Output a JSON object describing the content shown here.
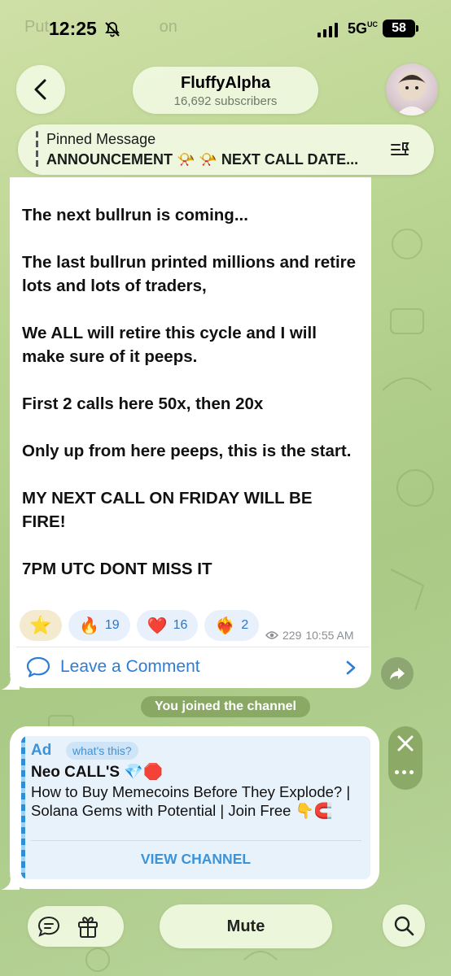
{
  "status_bar": {
    "time": "12:25",
    "network": "5G",
    "network_sup": "UC",
    "battery": "58"
  },
  "background_ghost": {
    "prev_title": "Put",
    "prev_title_end": "on"
  },
  "header": {
    "back_icon": "chevron-left-icon",
    "channel_name": "FluffyAlpha",
    "subscribers": "16,692 subscribers"
  },
  "pinned": {
    "title": "Pinned Message",
    "text": "ANNOUNCEMENT 📯 📯 NEXT CALL DATE..."
  },
  "message": {
    "paragraphs": [
      "The next bullrun is coming...",
      "The last bullrun printed millions and retire lots and lots of traders,",
      "We ALL will retire this cycle and I will make sure of it peeps.",
      "First 2 calls here 50x, then 20x",
      "Only up from here peeps, this is the start.",
      "MY NEXT CALL ON FRIDAY WILL BE FIRE!",
      "7PM UTC DONT MISS IT"
    ],
    "reactions": [
      {
        "emoji": "⭐",
        "count": ""
      },
      {
        "emoji": "🔥",
        "count": "19"
      },
      {
        "emoji": "❤️",
        "count": "16"
      },
      {
        "emoji": "❤️‍🔥",
        "count": "2"
      }
    ],
    "views": "229",
    "time": "10:55 AM",
    "comment_label": "Leave a Comment"
  },
  "service_message": "You joined the channel",
  "ad": {
    "label": "Ad",
    "whats_this": "what's this?",
    "title": "Neo CALL'S 💎🛑",
    "body": "How to Buy Memecoins Before They Explode?  | Solana Gems with Potential | Join Free 👇🧲",
    "cta": "VIEW CHANNEL"
  },
  "bottom_bar": {
    "mute_label": "Mute"
  }
}
